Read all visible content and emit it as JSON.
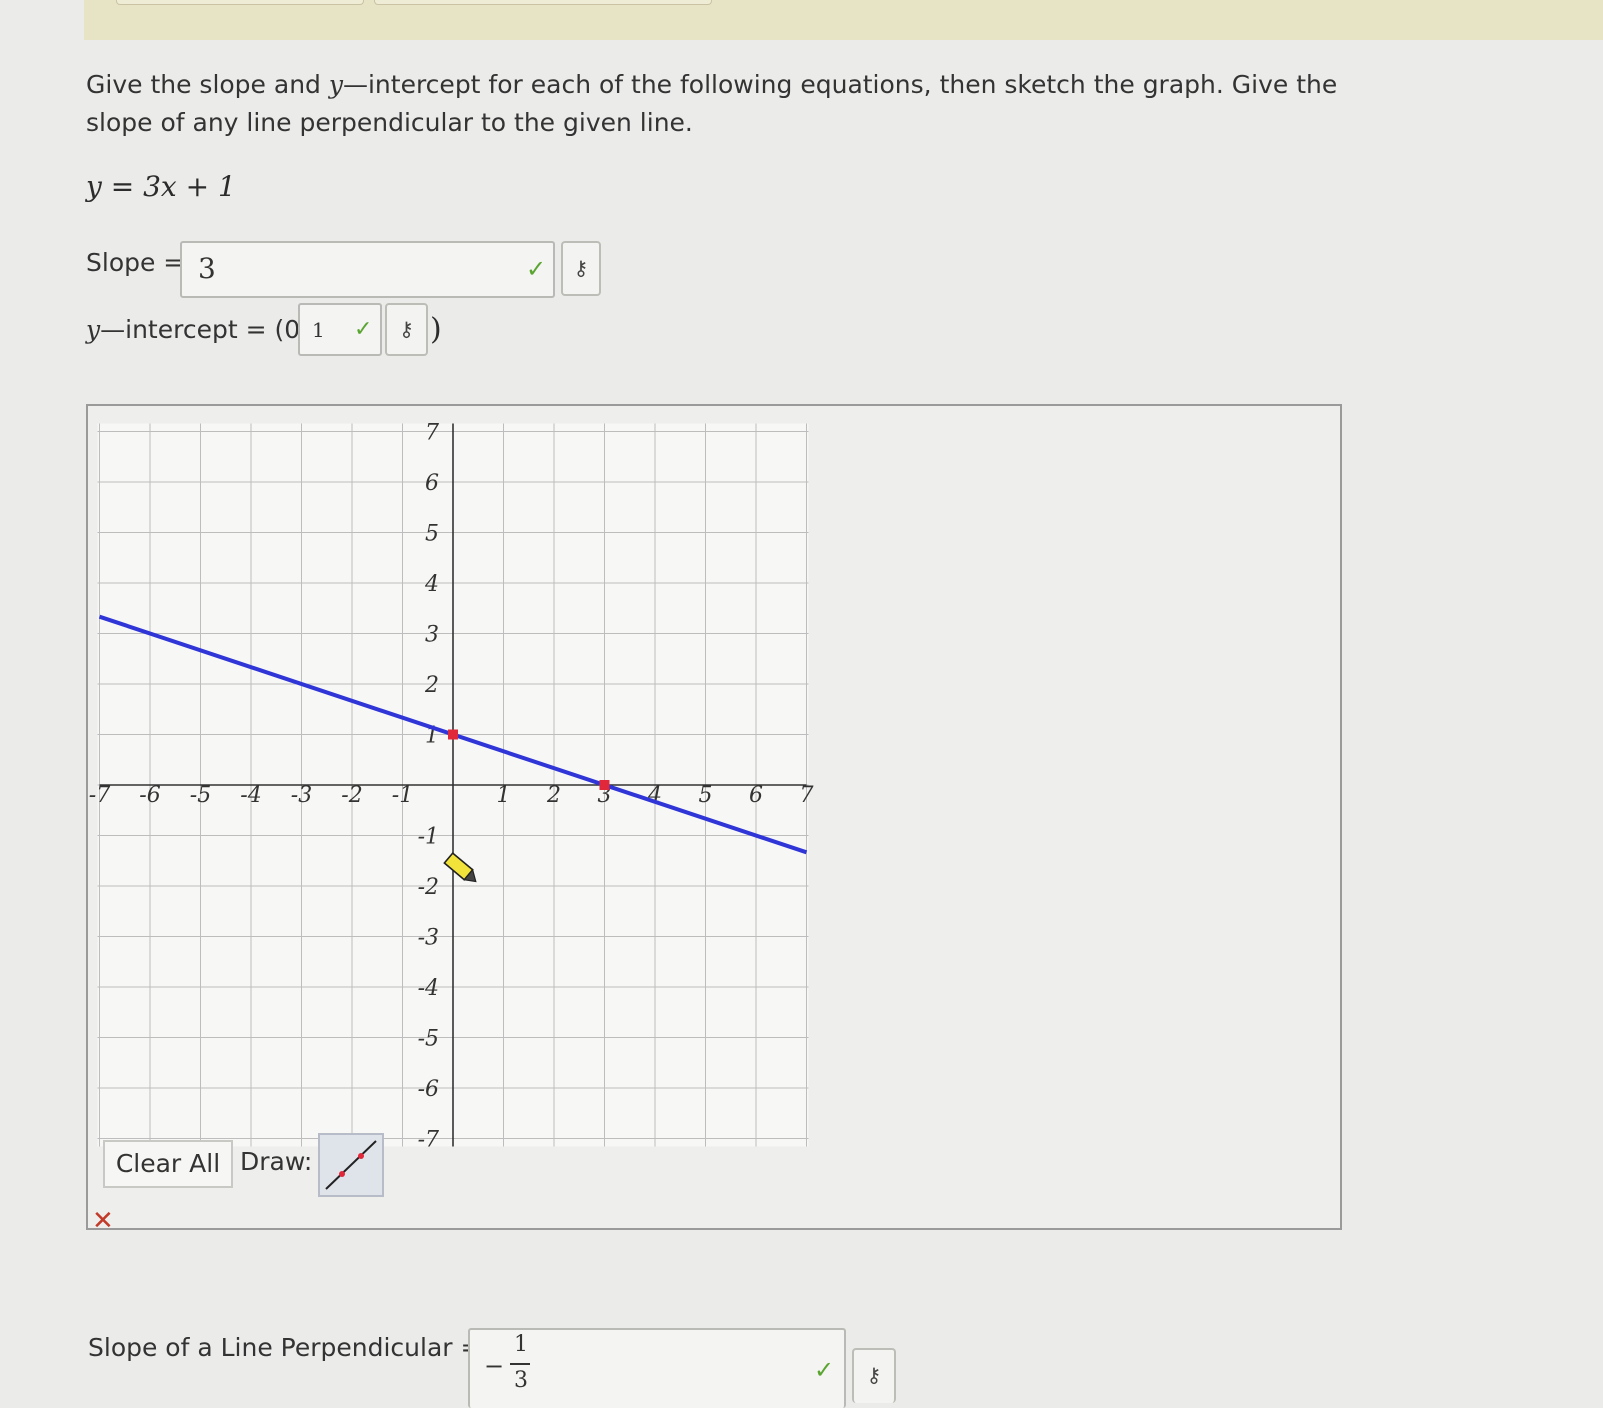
{
  "instructions": {
    "part1": "Give the slope and ",
    "var_y": "y",
    "part2": "—intercept for each of the following equations, then sketch the graph. Give the slope of any line perpendicular to the given line."
  },
  "equation": "y = 3x + 1",
  "slope": {
    "label": "Slope =",
    "value": "3",
    "status": "correct",
    "key_icon": "key-icon"
  },
  "intercept": {
    "label_var": "y",
    "label_rest": "—intercept = (0,",
    "value": "1",
    "close_paren": ")",
    "status": "correct",
    "key_icon": "key-icon"
  },
  "graph": {
    "axis_range": {
      "x": [
        -7,
        7
      ],
      "y": [
        -7,
        7
      ]
    },
    "x_tick_labels": [
      "-7",
      "-6",
      "-5",
      "-4",
      "-3",
      "-2",
      "-1",
      "1",
      "2",
      "3",
      "4",
      "5",
      "6",
      "7"
    ],
    "y_tick_labels": [
      "7",
      "6",
      "5",
      "4",
      "3",
      "2",
      "1",
      "-1",
      "-2",
      "-3",
      "-4",
      "-5",
      "-6",
      "-7"
    ],
    "line_points": [
      {
        "x": 0,
        "y": 1
      },
      {
        "x": 3,
        "y": 0
      }
    ],
    "line_color": "#2f35d6",
    "point_color": "#e0283a",
    "grid": true
  },
  "tools": {
    "clear_label": "Clear All",
    "draw_label": "Draw:",
    "draw_tool_icon": "line-segment-tool-icon"
  },
  "graph_status": {
    "icon": "x-mark",
    "color": "#c23a2a"
  },
  "perpendicular": {
    "label": "Slope of a Line Perpendicular =",
    "sign": "−",
    "numerator": "1",
    "denominator": "3",
    "status": "correct"
  },
  "colors": {
    "correct_check": "#5aa531",
    "incorrect": "#c23a2a"
  }
}
